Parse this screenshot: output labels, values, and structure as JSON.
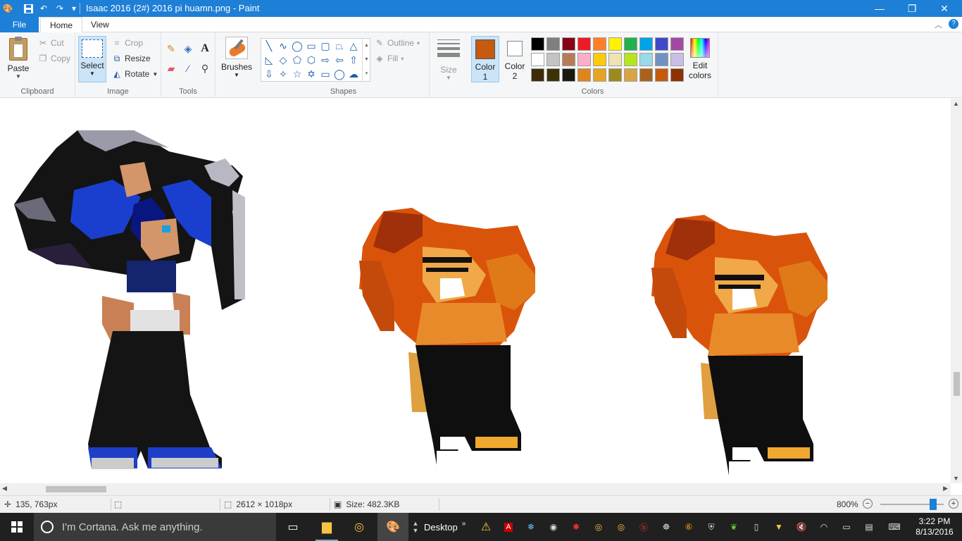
{
  "window": {
    "title": "Isaac 2016 (2#) 2016 pi huamn.png - Paint",
    "minimize_glyph": "—",
    "restore_glyph": "❐",
    "close_glyph": "✕"
  },
  "tabs": {
    "file": "File",
    "home": "Home",
    "view": "View"
  },
  "ribbon": {
    "clipboard": {
      "label": "Clipboard",
      "paste": "Paste",
      "cut": "Cut",
      "copy": "Copy"
    },
    "image": {
      "label": "Image",
      "select": "Select",
      "crop": "Crop",
      "resize": "Resize",
      "rotate": "Rotate"
    },
    "tools": {
      "label": "Tools"
    },
    "brushes": {
      "label": "Brushes"
    },
    "shapes": {
      "label": "Shapes",
      "outline": "Outline",
      "fill": "Fill"
    },
    "size": {
      "label": "Size"
    },
    "colors": {
      "label": "Colors",
      "color1": "Color",
      "color1_num": "1",
      "color2": "Color",
      "color2_num": "2",
      "edit_colors_1": "Edit",
      "edit_colors_2": "colors",
      "color1_value": "#c55a11",
      "color2_value": "#ffffff",
      "palette": [
        "#000000",
        "#7f7f7f",
        "#880015",
        "#ed1c24",
        "#ff7f27",
        "#fff200",
        "#22b14c",
        "#00a2e8",
        "#3f48cc",
        "#a349a4",
        "#ffffff",
        "#c3c3c3",
        "#b97a57",
        "#ffaec9",
        "#ffc90e",
        "#efe4b0",
        "#b5e61d",
        "#99d9ea",
        "#7092be",
        "#c8bfe7",
        "#3d2b0a",
        "#3b3305",
        "#1a1a10",
        "#e0851a",
        "#e6a422",
        "#9c8a1f",
        "#d9a441",
        "#a8621d",
        "#c45a0c",
        "#8b3305"
      ]
    }
  },
  "status": {
    "cursor_pos": "135, 763px",
    "dimensions": "2612 × 1018px",
    "file_size": "Size: 482.3KB",
    "zoom": "800%",
    "zoom_level_fraction": 0.88
  },
  "taskbar": {
    "cortana_placeholder": "I'm Cortana. Ask me anything.",
    "desktop_label": "Desktop",
    "time": "3:22 PM",
    "date": "8/13/2016"
  }
}
